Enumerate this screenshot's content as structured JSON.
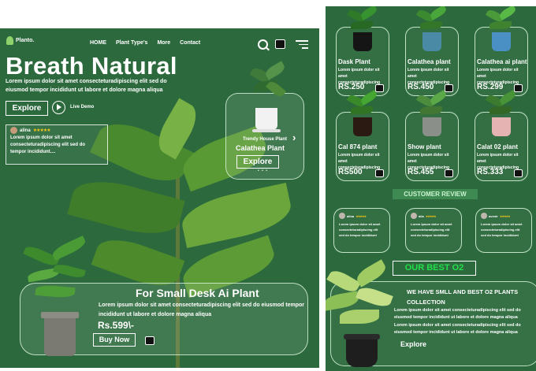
{
  "brand": "Planto.",
  "nav": {
    "home": "HOME",
    "plant_types": "Plant Type's",
    "more": "More",
    "contact": "Contact"
  },
  "hero": {
    "title": "Breath Natural",
    "subtitle": "Lorem ipsum dolor sit amet consecteturadipiscing elit sed do eiusmod tempor incididunt ut labore et dolore magna aliqua",
    "explore": "Explore",
    "live_demo": "Live Demo"
  },
  "review": {
    "name": "alina",
    "stars": "★★★★★",
    "text": "Lorem ipsum dolor sit amet consecteturadipiscing elit sed do tempor incididunt...."
  },
  "trendy": {
    "label": "Trendy House Plant",
    "name": "Calathea Plant",
    "button": "Explore",
    "dots": "• • •",
    "arrow": "›"
  },
  "desk": {
    "title": "For Small Desk Ai Plant",
    "desc": "Lorem ipsum dolor sit amet consecteturadipiscing elit sed do eiusmod tempor incididunt ut labore et dolore magna aliqua",
    "price": "Rs.599\\-",
    "buy": "Buy Now"
  },
  "products": [
    {
      "name": "Dask Plant",
      "desc": "Lorem ipsum dolor sit amet consecteturadipiscing",
      "price": "RS.250"
    },
    {
      "name": "Calathea plant",
      "desc": "Lorem ipsum dolor sit amet consecteturadipiscing",
      "price": "RS.450"
    },
    {
      "name": "Calathea ai plant",
      "desc": "Lorem ipsum dolor sit amet consecteturadipiscing",
      "price": "RS.299"
    },
    {
      "name": "Cal 874 plant",
      "desc": "Lorem ipsum dolor sit amet consecteturadipiscing",
      "price": "RS500"
    },
    {
      "name": "Show plant",
      "desc": "Lorem ipsum dolor sit amet consecteturadipiscing",
      "price": "RS.455"
    },
    {
      "name": "Calat 02 plant",
      "desc": "Lorem ipsum dolor sit amet consecteturadipiscing",
      "price": "RS.333"
    }
  ],
  "customer_review": {
    "heading": "CUSTOMER REVIEW",
    "reviews": [
      {
        "name": "alina",
        "stars": "★★★★★",
        "text": "Lorem ipsum dolor sit amet consecteturadipiscing elit sed do tempor incididunt"
      },
      {
        "name": "alia",
        "stars": "★★★★★",
        "text": "Lorem ipsum dolor sit amet consecteturadipiscing elit sed do tempor incididunt"
      },
      {
        "name": "avenir",
        "stars": "★★★★★",
        "text": "Lorem ipsum dolor sit amet consecteturadipiscing elit sed do tempor incididunt"
      }
    ]
  },
  "best": {
    "heading": "OUR BEST O2",
    "title": "WE HAVE  SMLL AND BEST O2 PLANTS COLLECTION",
    "desc1": "Lorem ipsum dolor sit amet consecteturadipiscing elit sed do eiusmod tempor incididunt ut labore et dolore magna aliqua",
    "desc2": "Lorem ipsum dolor sit amet consecteturadipiscing elit sed do eiusmod tempor incididunt ut labore et dolore magna aliqua",
    "explore": "Explore"
  },
  "colors": {
    "bg_green": "#2c6a3d",
    "accent_green": "#22e04a",
    "star": "#f5c518"
  }
}
